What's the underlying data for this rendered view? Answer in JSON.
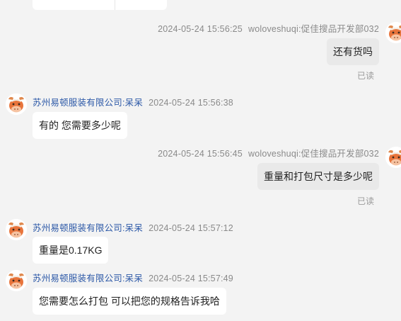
{
  "messages": [
    {
      "side": "out",
      "sender": "woloveshuqi:促佳搜品开发部032",
      "time": "2024-05-24 15:56:25",
      "text": "还有货吗",
      "status": "已读"
    },
    {
      "side": "in",
      "sender": "苏州易顿服装有限公司:呆呆",
      "time": "2024-05-24 15:56:38",
      "text": "有的 您需要多少呢"
    },
    {
      "side": "out",
      "sender": "woloveshuqi:促佳搜品开发部032",
      "time": "2024-05-24 15:56:45",
      "text": "重量和打包尺寸是多少呢",
      "status": "已读"
    },
    {
      "side": "in",
      "sender": "苏州易顿服装有限公司:呆呆",
      "time": "2024-05-24 15:57:12",
      "text": "重量是0.17KG"
    },
    {
      "side": "in",
      "sender": "苏州易顿服装有限公司:呆呆",
      "time": "2024-05-24 15:57:49",
      "text": "您需要怎么打包 可以把您的规格告诉我哈"
    }
  ]
}
